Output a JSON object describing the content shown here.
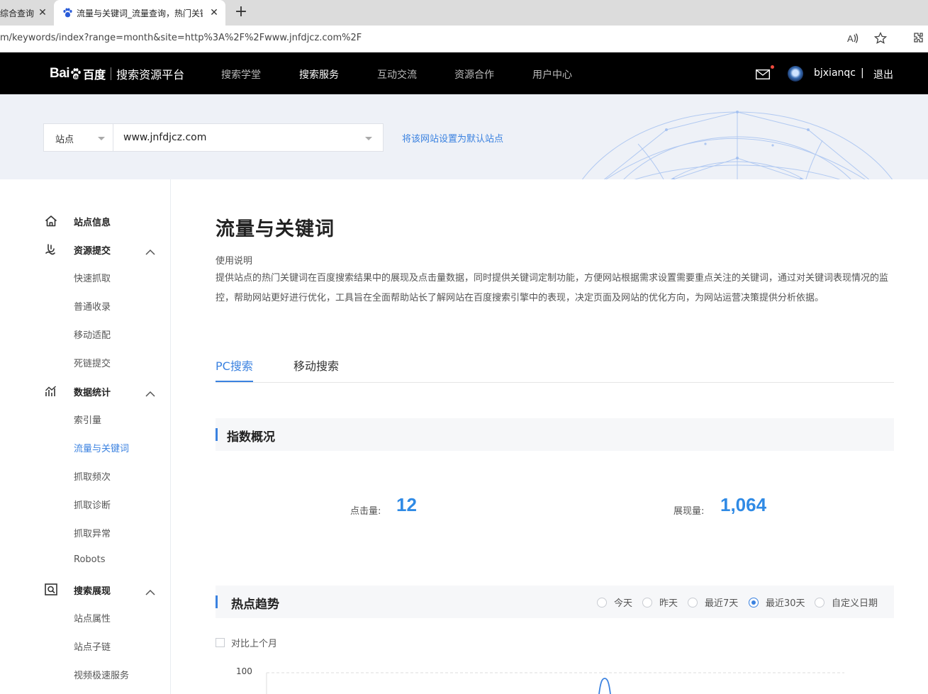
{
  "browser": {
    "tabs": [
      {
        "title": "综合查询 - ",
        "close": "✕",
        "active": false
      },
      {
        "title": "流量与关键词_流量查询，热门关键",
        "close": "✕",
        "active": true
      }
    ],
    "new_tab": "+",
    "url": "m/keywords/index?range=month&site=http%3A%2F%2Fwww.jnfdjcz.com%2F"
  },
  "header": {
    "logo_bai": "Bai",
    "logo_du": "百度",
    "logo_text": "搜索资源平台",
    "nav": [
      {
        "label": "搜索学堂",
        "active": false
      },
      {
        "label": "搜索服务",
        "active": true
      },
      {
        "label": "互动交流",
        "active": false
      },
      {
        "label": "资源合作",
        "active": false
      },
      {
        "label": "用户中心",
        "active": false
      }
    ],
    "username": "bjxianqc",
    "separator": "|",
    "logout": "退出"
  },
  "sitebar": {
    "type_label": "站点",
    "site_value": "www.jnfdjcz.com",
    "set_default": "将该网站设置为默认站点"
  },
  "sidebar": {
    "groups": [
      {
        "title": "站点信息",
        "icon": "home-icon",
        "children": []
      },
      {
        "title": "资源提交",
        "icon": "submit-icon",
        "children": [
          "快速抓取",
          "普通收录",
          "移动适配",
          "死链提交"
        ]
      },
      {
        "title": "数据统计",
        "icon": "stats-icon",
        "children": [
          "索引量",
          "流量与关键词",
          "抓取频次",
          "抓取诊断",
          "抓取异常",
          "Robots"
        ]
      },
      {
        "title": "搜索展现",
        "icon": "search-display-icon",
        "children": [
          "站点属性",
          "站点子链",
          "视频极速服务"
        ]
      }
    ],
    "active_item": "流量与关键词"
  },
  "main": {
    "title": "流量与关键词",
    "usage_heading": "使用说明",
    "usage_text": "提供站点的热门关键词在百度搜索结果中的展现及点击量数据，同时提供关键词定制功能，方便网站根据需求设置需要重点关注的关键词，通过对关键词表现情况的监控，帮助网站更好进行优化，工具旨在全面帮助站长了解网站在百度搜索引擎中的表现，决定页面及网站的优化方向，为网站运营决策提供分析依据。",
    "tabs": [
      {
        "label": "PC搜索",
        "active": true
      },
      {
        "label": "移动搜索",
        "active": false
      }
    ],
    "overview": {
      "title": "指数概况",
      "clicks_label": "点击量:",
      "clicks_value": "12",
      "impressions_label": "展现量:",
      "impressions_value": "1,064"
    },
    "trend": {
      "title": "热点趋势",
      "ranges": [
        {
          "label": "今天",
          "selected": false
        },
        {
          "label": "昨天",
          "selected": false
        },
        {
          "label": "最近7天",
          "selected": false
        },
        {
          "label": "最近30天",
          "selected": true
        },
        {
          "label": "自定义日期",
          "selected": false
        }
      ],
      "compare_label": "对比上个月",
      "y_top_label": "100"
    }
  },
  "colors": {
    "accent": "#3b82e0",
    "stat_value": "#2f8ae5",
    "header_bg": "#000000",
    "sitebar_bg": "#eef1f7"
  }
}
